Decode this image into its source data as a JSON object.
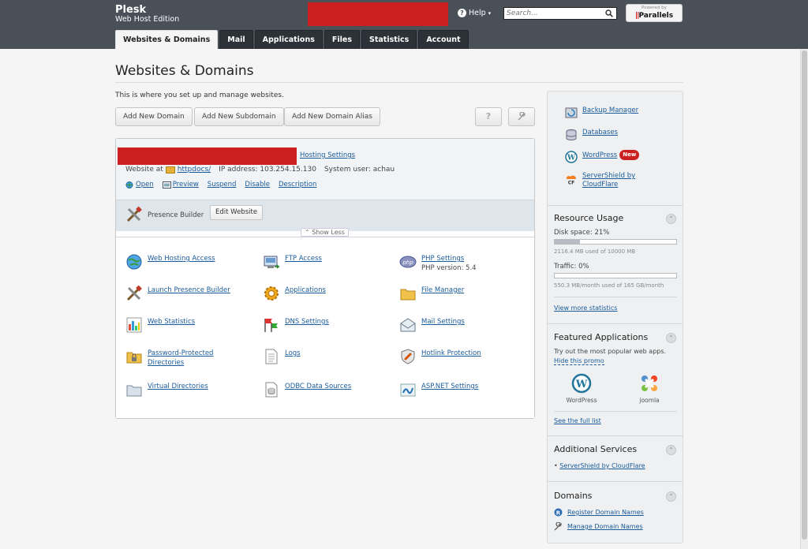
{
  "header": {
    "brand_title": "Plesk",
    "brand_sub": "Web Host Edition",
    "help_label": "Help",
    "search_placeholder": "Search...",
    "powered_by": "Powered by",
    "parallels": "Parallels"
  },
  "tabs": [
    "Websites & Domains",
    "Mail",
    "Applications",
    "Files",
    "Statistics",
    "Account"
  ],
  "main": {
    "title": "Websites & Domains",
    "intro": "This is where you set up and manage websites.",
    "buttons": {
      "add_domain": "Add New Domain",
      "add_subdomain": "Add New Subdomain",
      "add_alias": "Add New Domain Alias"
    },
    "help_btn": "?"
  },
  "domain": {
    "hosting_settings": "Hosting Settings",
    "website_at": "Website at",
    "docroot": "httpdocs/",
    "ip": "IP address: 103.254.15.130",
    "user": "System user: achau",
    "actions": [
      "Open",
      "Preview",
      "Suspend",
      "Disable",
      "Description"
    ],
    "builder_label": "Presence Builder",
    "edit_website": "Edit Website",
    "show_less": "Show Less",
    "php_version": "PHP version: 5.4",
    "tools": {
      "web_hosting_access": "Web Hosting Access",
      "ftp_access": "FTP Access",
      "php_settings": "PHP Settings",
      "launch_builder": "Launch Presence Builder",
      "applications": "Applications",
      "file_manager": "File Manager",
      "web_statistics": "Web Statistics",
      "dns_settings": "DNS Settings",
      "mail_settings": "Mail Settings",
      "pwd_dirs_1": "Password-Protected",
      "pwd_dirs_2": "Directories",
      "logs": "Logs",
      "hotlink": "Hotlink Protection",
      "virtual_dirs": "Virtual Directories",
      "odbc": "ODBC Data Sources",
      "aspnet": "ASP.NET Settings"
    }
  },
  "sidebar": {
    "links": {
      "backup": "Backup Manager",
      "databases": "Databases",
      "wordpress": "WordPress",
      "new_badge": "New",
      "servershield_1": "ServerShield by",
      "servershield_2": "CloudFlare"
    },
    "resource": {
      "title": "Resource Usage",
      "disk": "Disk space: 21%",
      "disk_fraction": 0.21,
      "disk_detail": "2116.4 MB used of 10000 MB",
      "traffic": "Traffic: 0%",
      "traffic_fraction": 0.0,
      "traffic_detail": "550.3 MB/month used of 165 GB/month",
      "more": "View more statistics"
    },
    "featured": {
      "title": "Featured Applications",
      "desc": "Try out the most popular web apps.",
      "hide": "Hide this promo",
      "apps": [
        "WordPress",
        "joomla"
      ],
      "full_list": "See the full list"
    },
    "additional": {
      "title": "Additional Services",
      "item": "ServerShield by CloudFlare"
    },
    "domains": {
      "title": "Domains",
      "register": "Register Domain Names",
      "manage": "Manage Domain Names"
    }
  }
}
